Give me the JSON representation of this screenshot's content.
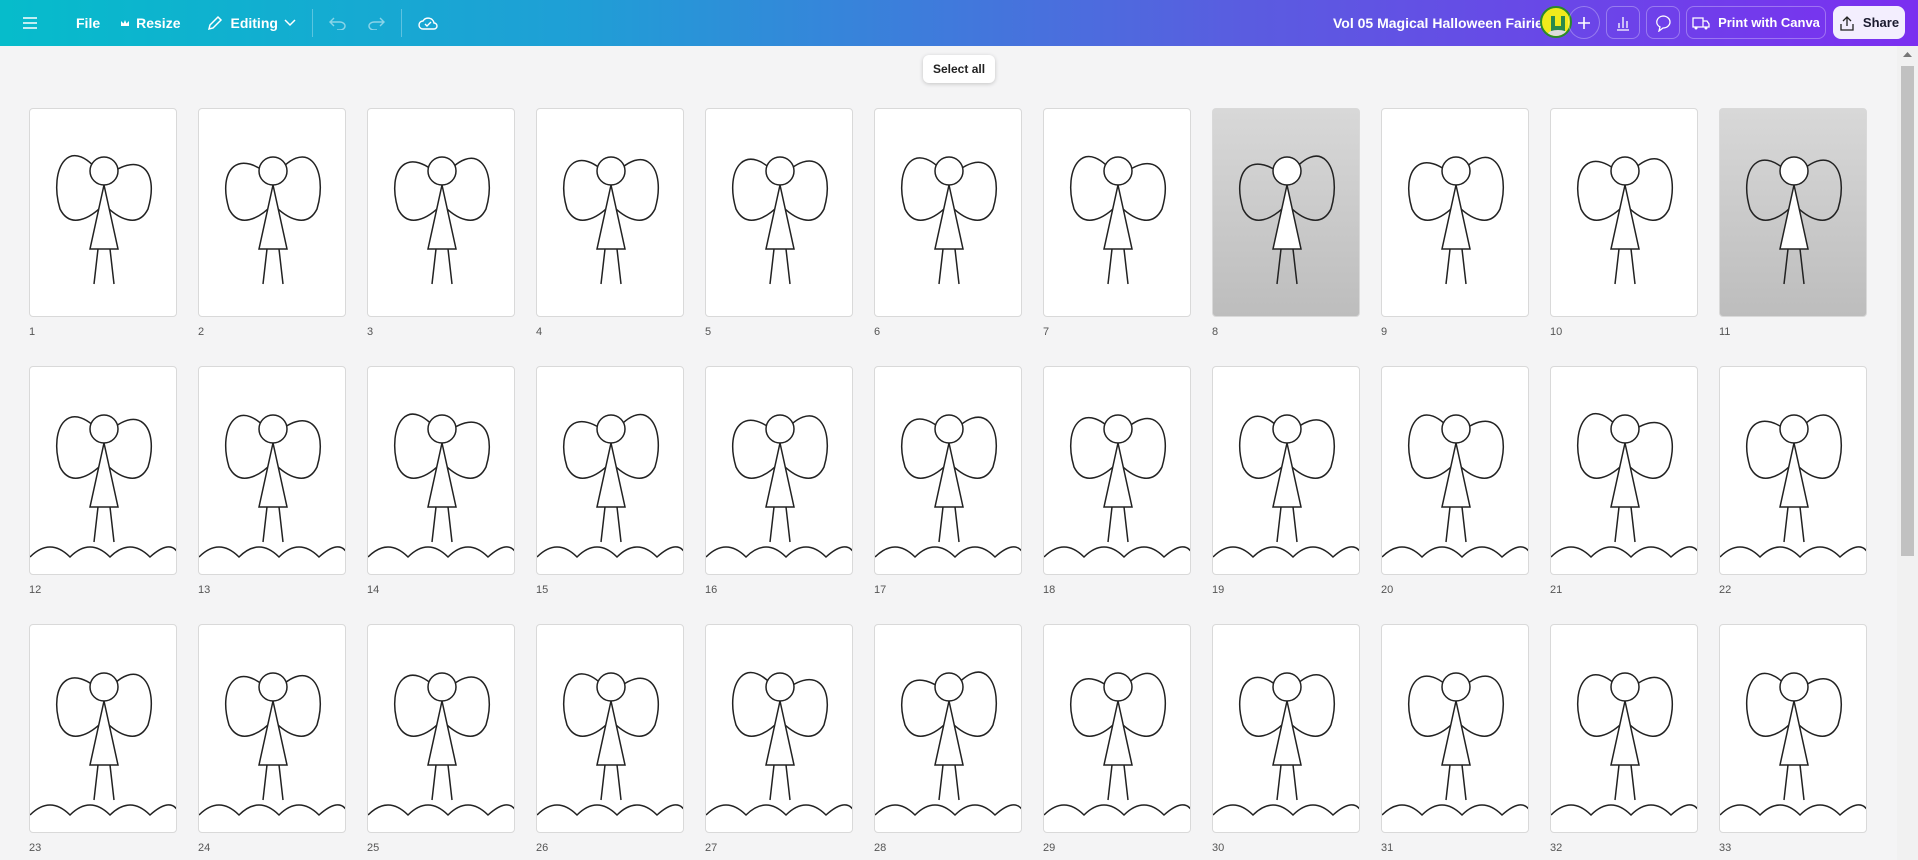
{
  "toolbar": {
    "menu_icon": "hamburger-icon",
    "file": "File",
    "resize": "Resize",
    "editing": "Editing",
    "undo_icon": "undo-icon",
    "redo_icon": "redo-icon",
    "cloud_icon": "cloud-check-icon"
  },
  "header": {
    "title": "Vol 05 Magical Halloween Fairies",
    "add_icon": "plus-icon",
    "analytics_icon": "bar-chart-icon",
    "comment_icon": "comment-icon",
    "print_label": "Print with Canva",
    "share_label": "Share"
  },
  "tooltip": "Select all",
  "colors": {
    "gradient_start": "#06bccb",
    "gradient_end": "#7b2ff0"
  },
  "pages": [
    {
      "n": "1"
    },
    {
      "n": "2"
    },
    {
      "n": "3"
    },
    {
      "n": "4"
    },
    {
      "n": "5"
    },
    {
      "n": "6"
    },
    {
      "n": "7"
    },
    {
      "n": "8",
      "tone": "gray"
    },
    {
      "n": "9"
    },
    {
      "n": "10"
    },
    {
      "n": "11",
      "tone": "gray"
    },
    {
      "n": "12"
    },
    {
      "n": "13"
    },
    {
      "n": "14"
    },
    {
      "n": "15"
    },
    {
      "n": "16"
    },
    {
      "n": "17"
    },
    {
      "n": "18"
    },
    {
      "n": "19"
    },
    {
      "n": "20"
    },
    {
      "n": "21"
    },
    {
      "n": "22"
    },
    {
      "n": "23"
    },
    {
      "n": "24"
    },
    {
      "n": "25"
    },
    {
      "n": "26"
    },
    {
      "n": "27"
    },
    {
      "n": "28"
    },
    {
      "n": "29"
    },
    {
      "n": "30"
    },
    {
      "n": "31"
    },
    {
      "n": "32"
    },
    {
      "n": "33"
    }
  ]
}
